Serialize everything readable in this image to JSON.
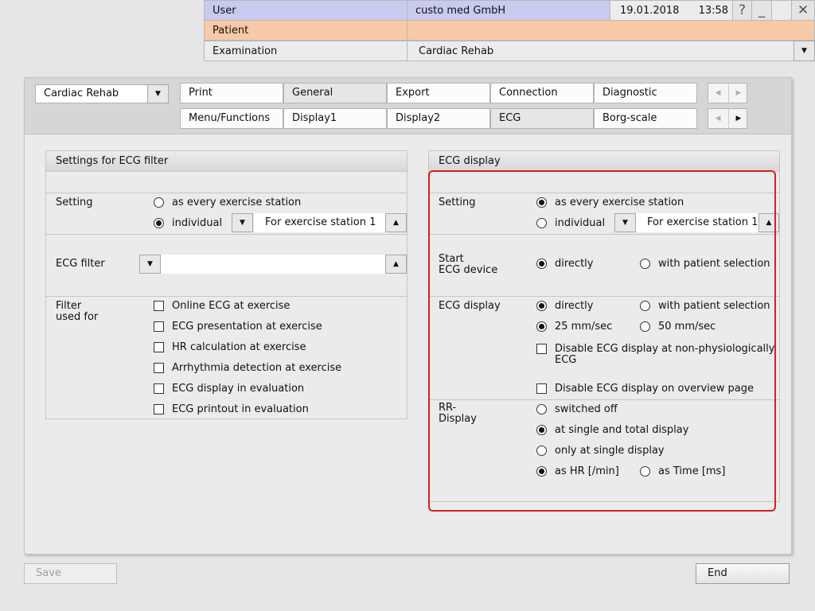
{
  "header": {
    "user_label": "User",
    "user_value": "custo med GmbH",
    "date": "19.01.2018",
    "time": "13:58",
    "patient_label": "Patient",
    "patient_value": "",
    "examination_label": "Examination",
    "examination_value": "Cardiac Rehab",
    "help_symbol": "?",
    "minimize_symbol": "_",
    "close_symbol": "✕"
  },
  "profile_select": {
    "value": "Cardiac Rehab"
  },
  "tabs_row1": [
    "Print",
    "General",
    "Export",
    "Connection",
    "Diagnostic"
  ],
  "tabs_row2": [
    "Menu/Functions",
    "Display1",
    "Display2",
    "ECG",
    "Borg-scale"
  ],
  "selected_tab": "ECG",
  "left_panel": {
    "title": "Settings for ECG filter",
    "setting_label": "Setting",
    "opt_every": "as every exercise station",
    "opt_individual": "individual",
    "station_value": "For exercise station 1",
    "ecg_filter_label": "ECG filter",
    "ecg_filter_value": "",
    "filter_used_label1": "Filter",
    "filter_used_label2": "used for",
    "checks": [
      "Online ECG at exercise",
      "ECG presentation at exercise",
      "HR calculation at exercise",
      "Arrhythmia detection at exercise",
      "ECG display in evaluation",
      "ECG printout in evaluation"
    ]
  },
  "right_panel": {
    "title": "ECG display",
    "setting_label": "Setting",
    "opt_every": "as every exercise station",
    "opt_individual": "individual",
    "station_value": "For exercise station 1",
    "start_label1": "Start",
    "start_label2": "ECG device",
    "opt_directly": "directly",
    "opt_with_patient": "with patient selection",
    "ecg_display_label": "ECG display",
    "opt_25": "25 mm/sec",
    "opt_50": "50 mm/sec",
    "disable_nonphys1": "Disable ECG display at non-physiologically",
    "disable_nonphys2": "ECG",
    "disable_overview": "Disable ECG display on overview page",
    "rr_label1": "RR-",
    "rr_label2": "Display",
    "opt_switched_off": "switched off",
    "opt_single_total": "at single and total display",
    "opt_only_single": "only at single display",
    "opt_as_hr": "as HR [/min]",
    "opt_as_time": "as Time [ms]"
  },
  "buttons": {
    "save": "Save",
    "end": "End"
  },
  "colors": {
    "user_row": "#c8cbee",
    "patient_row": "#f8c9a6",
    "highlight": "#d62020"
  }
}
